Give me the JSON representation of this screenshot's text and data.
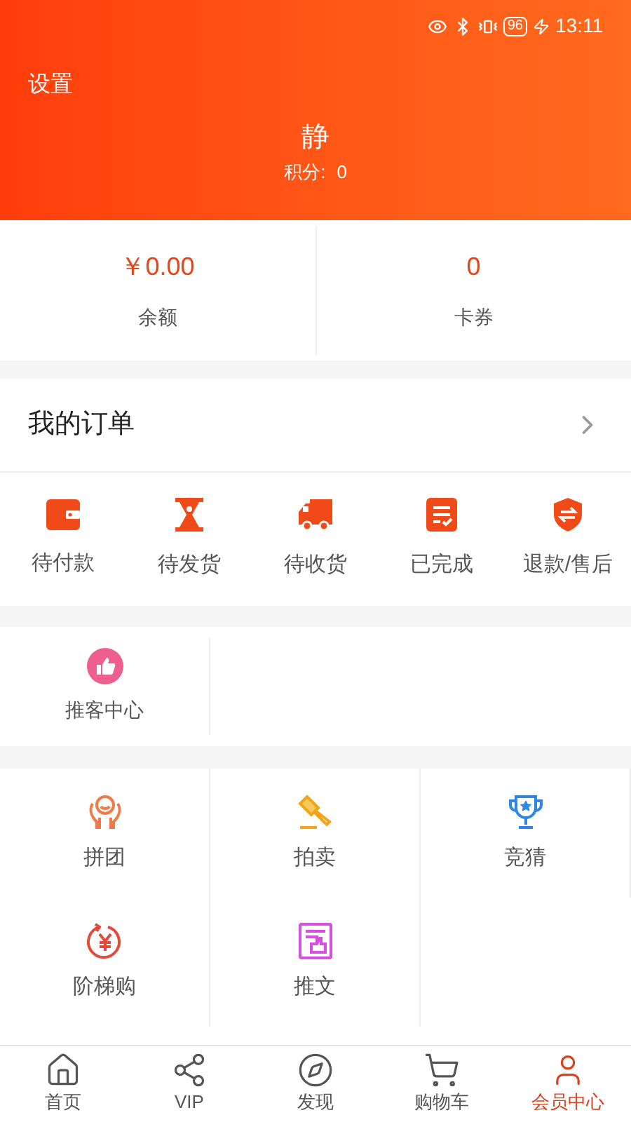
{
  "status_bar": {
    "battery": "96",
    "time": "13:11"
  },
  "header": {
    "settings": "设置",
    "username": "静",
    "points_label": "积分:",
    "points": "0"
  },
  "wallet": [
    {
      "value": "￥0.00",
      "label": "余额"
    },
    {
      "value": "0",
      "label": "卡券"
    }
  ],
  "orders": {
    "title": "我的订单",
    "items": [
      {
        "kind": "wallet",
        "label": "待付款"
      },
      {
        "kind": "hourglass",
        "label": "待发货"
      },
      {
        "kind": "truck",
        "label": "待收货"
      },
      {
        "kind": "checklist",
        "label": "已完成"
      },
      {
        "kind": "shield",
        "label": "退款/售后"
      }
    ]
  },
  "promo": [
    {
      "kind": "thumb",
      "label": "推客中心"
    }
  ],
  "services": [
    {
      "kind": "group",
      "label": "拼团"
    },
    {
      "kind": "gavel",
      "label": "拍卖"
    },
    {
      "kind": "trophy",
      "label": "竞猜"
    },
    {
      "kind": "yen",
      "label": "阶梯购"
    },
    {
      "kind": "article",
      "label": "推文"
    }
  ],
  "tab_bar": [
    {
      "kind": "home",
      "label": "首页",
      "selected": false
    },
    {
      "kind": "share",
      "label": "VIP",
      "selected": false
    },
    {
      "kind": "compass",
      "label": "发现",
      "selected": false
    },
    {
      "kind": "cart",
      "label": "购物车",
      "selected": false
    },
    {
      "kind": "user",
      "label": "会员中心",
      "selected": true
    }
  ]
}
